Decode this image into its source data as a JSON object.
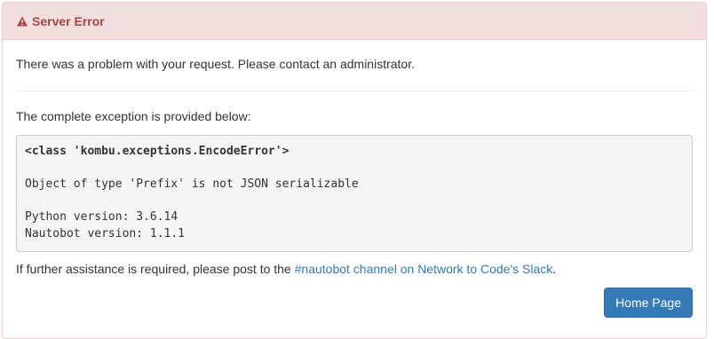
{
  "header": {
    "title": "Server Error",
    "icon": "warning-icon"
  },
  "message": "There was a problem with your request. Please contact an administrator.",
  "exception_label": "The complete exception is provided below:",
  "exception": {
    "class_line": "<class 'kombu.exceptions.EncodeError'>",
    "detail_line": "Object of type 'Prefix' is not JSON serializable",
    "python_version_line": "Python version: 3.6.14",
    "nautobot_version_line": "Nautobot version: 1.1.1"
  },
  "help": {
    "prefix": "If further assistance is required, please post to the ",
    "link_text": "#nautobot channel on Network to Code's Slack",
    "suffix": "."
  },
  "buttons": {
    "home_label": "Home Page"
  },
  "colors": {
    "danger_text": "#a94442",
    "danger_bg": "#f2dede",
    "danger_border": "#ebccd1",
    "link": "#337ab7",
    "primary_button": "#337ab7"
  }
}
